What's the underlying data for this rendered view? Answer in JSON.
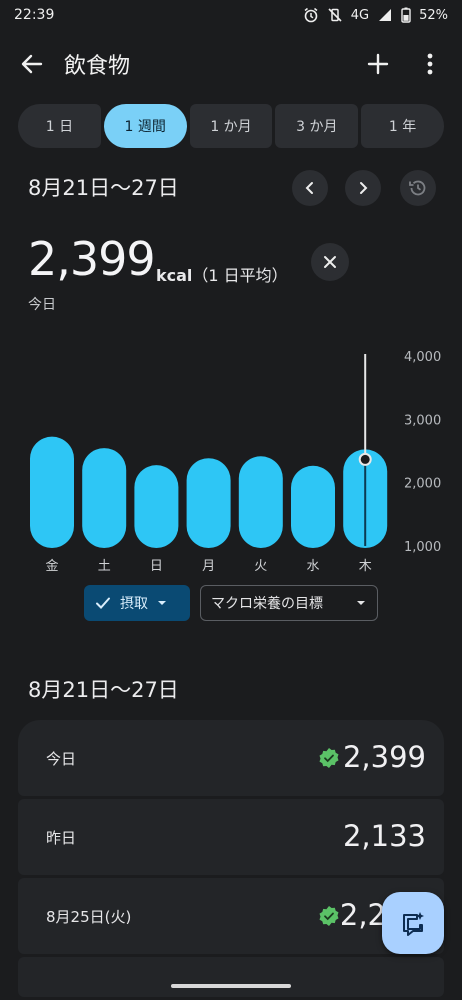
{
  "status": {
    "time": "22:39",
    "network": "4G",
    "battery": "52%"
  },
  "app_bar": {
    "title": "飲食物",
    "back_icon": "arrow-back-icon",
    "add_icon": "plus-icon",
    "more_icon": "more-vert-icon"
  },
  "tabs": [
    {
      "label": "1 日",
      "active": false
    },
    {
      "label": "1 週間",
      "active": true
    },
    {
      "label": "1 か月",
      "active": false
    },
    {
      "label": "3 か月",
      "active": false
    },
    {
      "label": "1 年",
      "active": false
    }
  ],
  "range": {
    "title": "8月21日〜27日"
  },
  "summary": {
    "value": "2,399",
    "unit": "kcal",
    "unit_note": "（1 日平均）",
    "today": "今日"
  },
  "chart_data": {
    "type": "bar",
    "categories": [
      "金",
      "土",
      "日",
      "月",
      "火",
      "水",
      "木"
    ],
    "values": [
      2600,
      2420,
      2150,
      2260,
      2290,
      2140,
      2399
    ],
    "ylim": [
      1000,
      4000
    ],
    "ticks": [
      "4,000",
      "3,000",
      "2,000",
      "1,000"
    ],
    "tick_values": [
      4000,
      3000,
      2000,
      1000
    ],
    "selected_index": 6,
    "bar_color": "#2ec6f5"
  },
  "chips": {
    "intake": "摂取",
    "macro": "マクロ栄養の目標"
  },
  "list": {
    "title": "8月21日〜27日",
    "rows": [
      {
        "label": "今日",
        "value": "2,399",
        "check": true
      },
      {
        "label": "昨日",
        "value": "2,133",
        "check": false
      },
      {
        "label": "8月25日(火)",
        "value": "2,2",
        "check": true
      }
    ]
  },
  "colors": {
    "background": "#1b1c1e",
    "accent": "#7ad0f7",
    "check": "#5bc267",
    "fab": "#a9d0ff"
  }
}
